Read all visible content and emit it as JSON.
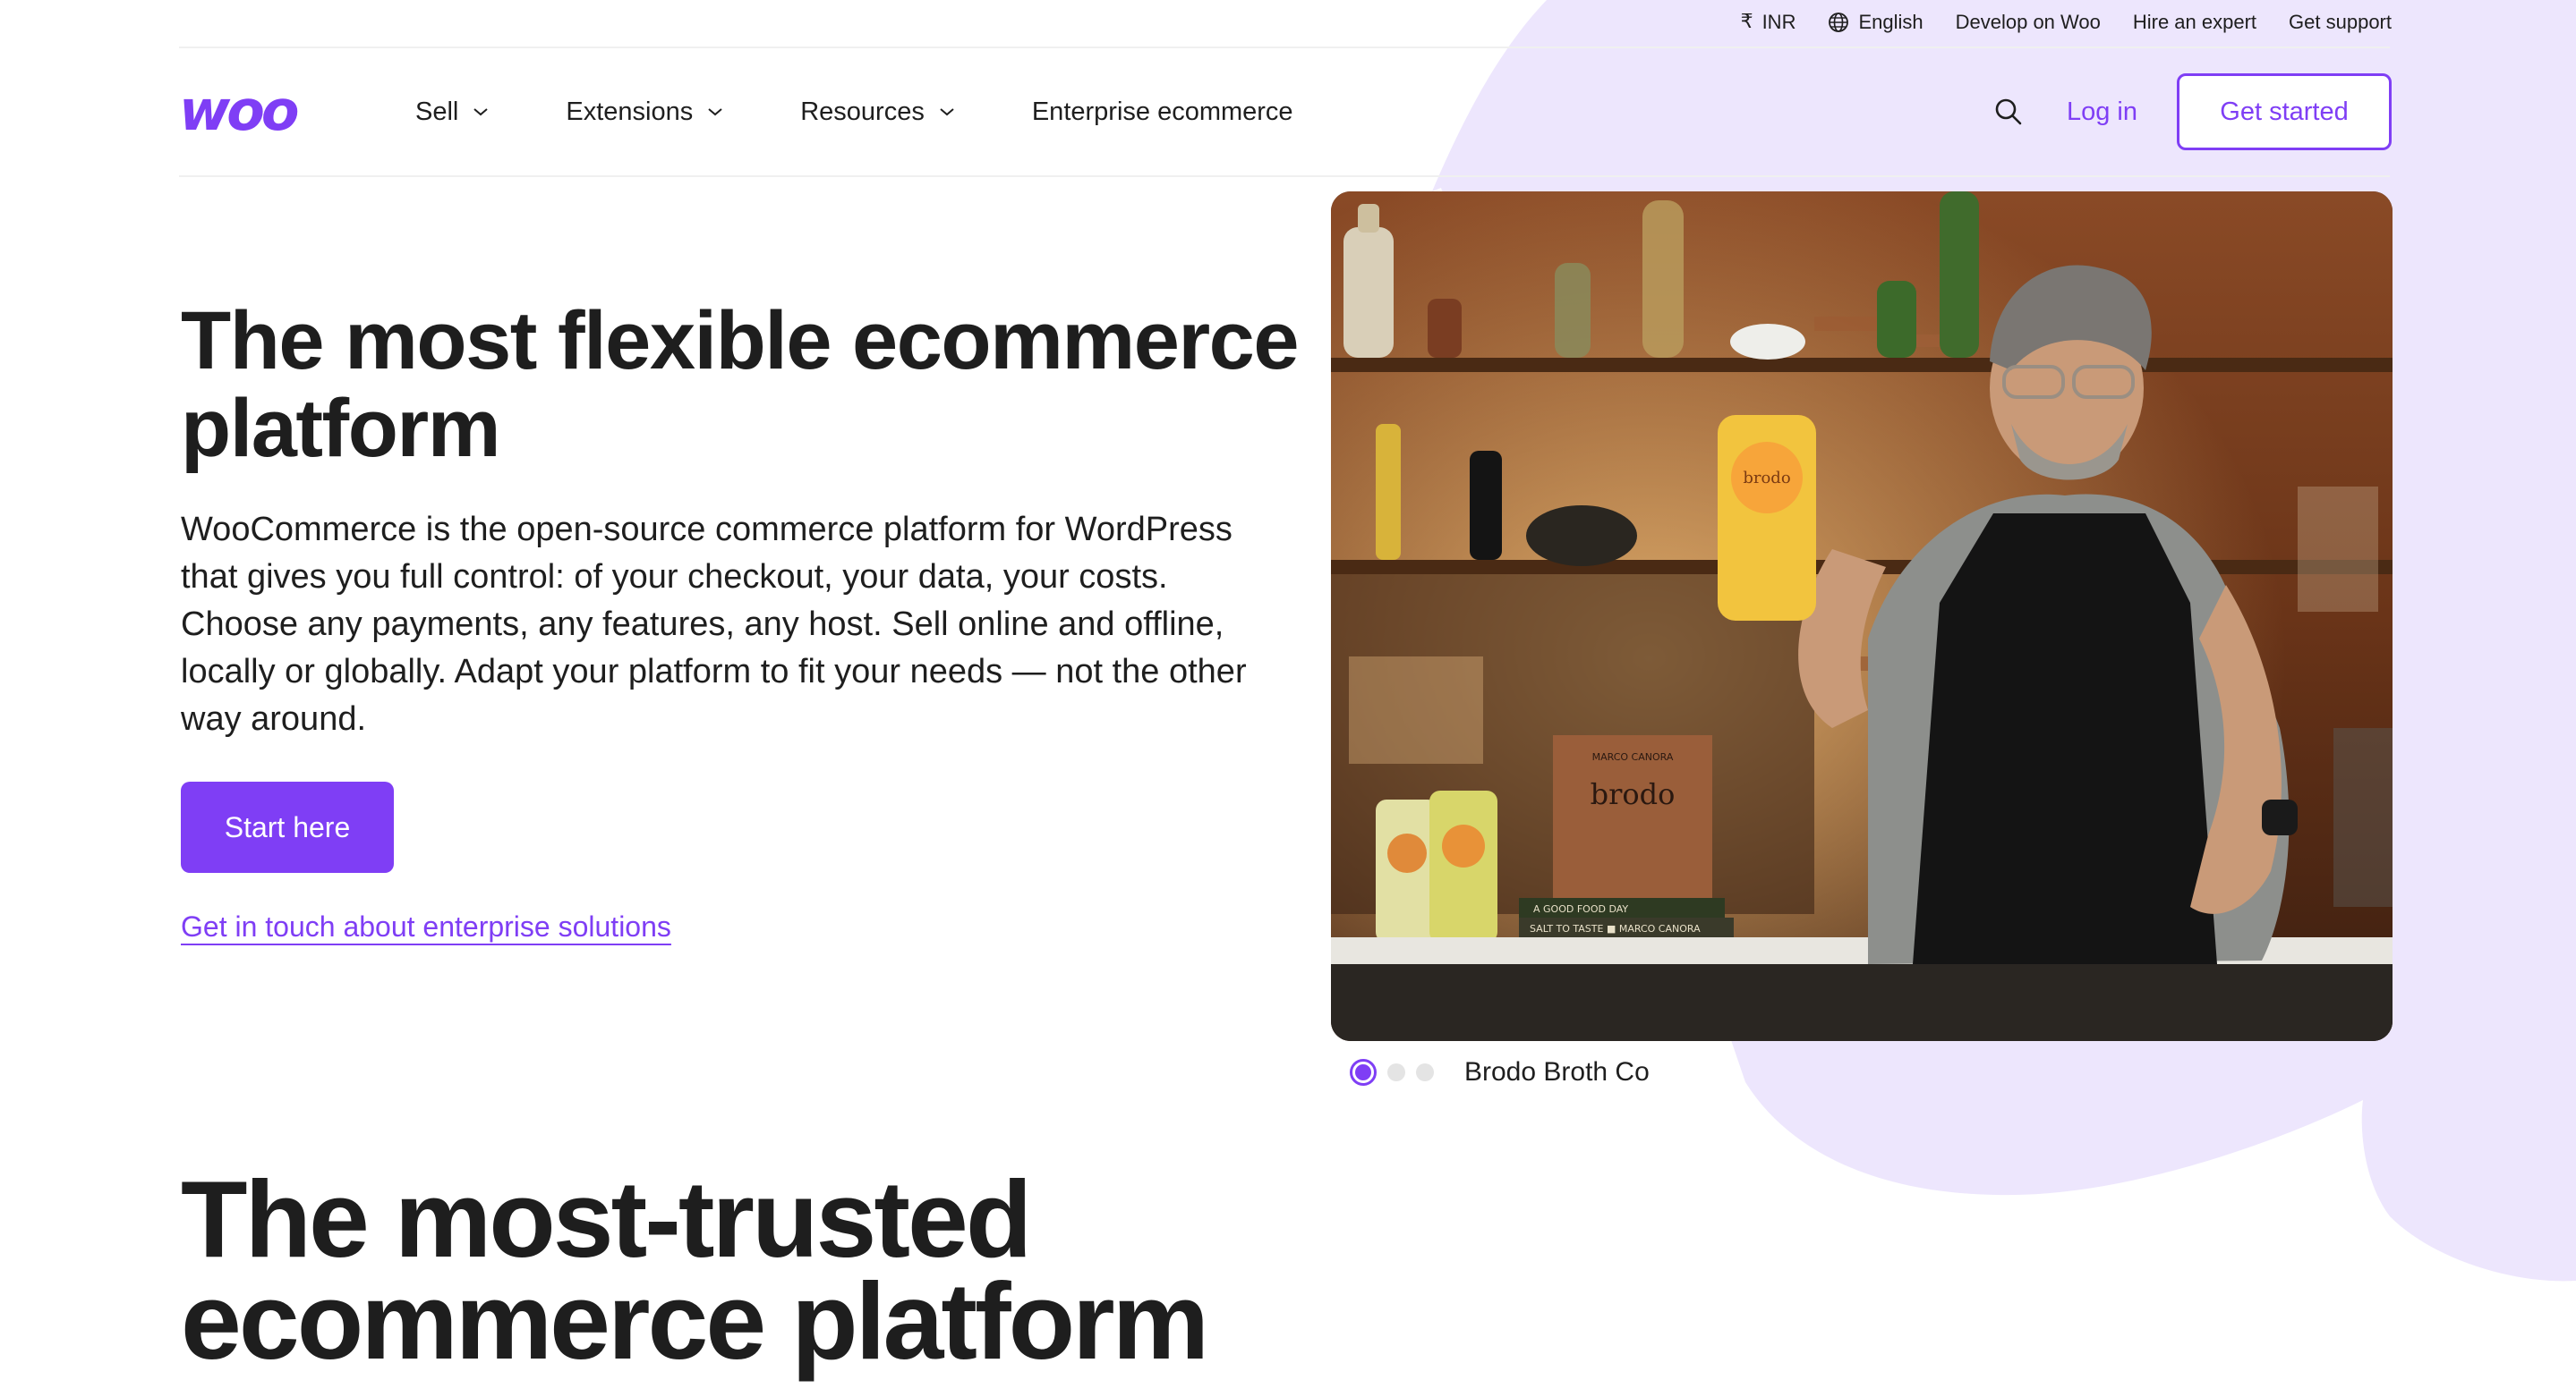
{
  "utility_bar": {
    "currency": "INR",
    "language": "English",
    "links": [
      "Develop on Woo",
      "Hire an expert",
      "Get support"
    ]
  },
  "nav": {
    "logo_text": "woo",
    "items": [
      {
        "label": "Sell",
        "has_dropdown": true
      },
      {
        "label": "Extensions",
        "has_dropdown": true
      },
      {
        "label": "Resources",
        "has_dropdown": true
      },
      {
        "label": "Enterprise ecommerce",
        "has_dropdown": false
      }
    ],
    "login": "Log in",
    "get_started": "Get started"
  },
  "hero": {
    "title": "The most flexible ecommerce platform",
    "description": "WooCommerce is the open-source commerce platform for WordPress that gives you full control: of your checkout, your data, your costs. Choose any payments, any features, any host. Sell online and offline, locally or globally. Adapt your platform to fit your needs — not the other way around.",
    "primary_cta": "Start here",
    "secondary_link": "Get in touch about enterprise solutions",
    "carousel": {
      "slides": 3,
      "active_index": 0,
      "caption": "Brodo Broth Co"
    },
    "image_text": {
      "book_title": "brodo",
      "book_author": "MARCO CANORA",
      "pouch_label": "brodo",
      "book_spine_1": "A GOOD FOOD DAY",
      "book_spine_2": "SALT TO TASTE ■ MARCO CANORA"
    }
  },
  "section2": {
    "title": "The most-trusted ecommerce platform"
  },
  "colors": {
    "brand": "#7f3ef5",
    "text": "#1e1e1e",
    "blob": "#ede6fd"
  },
  "icons": [
    "rupee-icon",
    "globe-icon",
    "chevron-down-icon",
    "search-icon"
  ]
}
